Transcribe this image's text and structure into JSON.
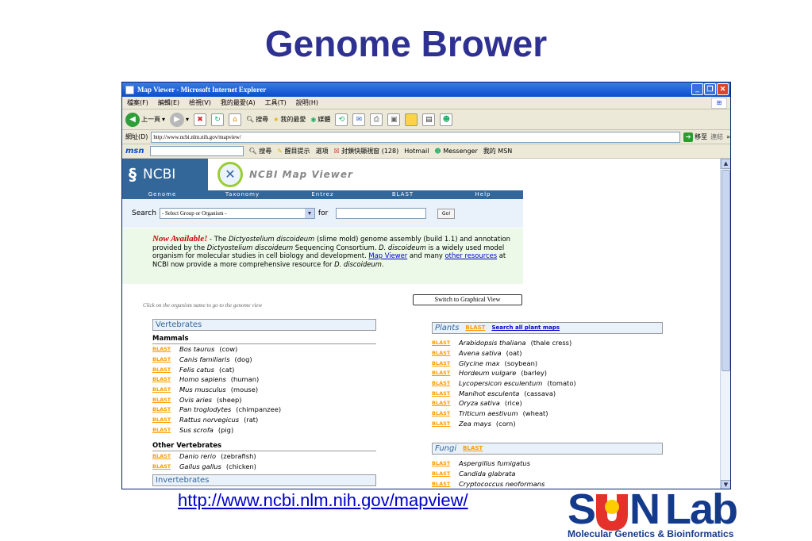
{
  "slide": {
    "title": "Genome Brower",
    "url": "http://www.ncbi.nlm.nih.gov/mapview/"
  },
  "logo": {
    "sun": "S",
    "n": "N",
    "lab": "Lab",
    "subtitle": "Molecular Genetics & Bioinformatics",
    "colors": {
      "blue": "#143a8c",
      "red": "#e4312b",
      "yellow": "#ffcc00"
    }
  },
  "browser": {
    "window_title": "Map Viewer - Microsoft Internet Explorer",
    "menu": [
      "檔案(F)",
      "編輯(E)",
      "檢視(V)",
      "我的最愛(A)",
      "工具(T)",
      "說明(H)"
    ],
    "toolbar": {
      "back": "上一頁",
      "search": "搜尋",
      "favorites": "我的最愛",
      "media": "媒體"
    },
    "address_label": "網址(D)",
    "address": "http://www.ncbi.nlm.nih.gov/mapview/",
    "go_label": "移至",
    "links_label": "連結",
    "msn": {
      "logo": "msn",
      "search": "搜尋",
      "highlight": "醒目提示",
      "options": "選項",
      "popup": "封鎖快顯視窗 (128)",
      "hotmail": "Hotmail",
      "messenger": "Messenger",
      "mymsn": "我的 MSN"
    }
  },
  "page": {
    "ncbi_logo": "NCBI",
    "map_viewer_title": "NCBI Map Viewer",
    "nav": [
      "Genome",
      "Taxonomy",
      "Entrez",
      "BLAST",
      "Help"
    ],
    "search_label": "Search",
    "search_select": "- Select Group or Organism -",
    "for_label": "for",
    "go_button": "Go!",
    "announce": {
      "now": "Now Available!",
      "t1": " - The ",
      "i1": "Dictyostelium discoideum",
      "t2": " (slime mold) genome assembly (build 1.1) and annotation provided by the ",
      "i2": "Dictyostelium discoideum",
      "t3": " Sequencing Consortium. ",
      "i3": "D. discoideum",
      "t4": " is a widely used model organism for molecular studies in cell biology and development. ",
      "link1": "Map Viewer",
      "t5": " and many ",
      "link2": "other resources",
      "t6": " at NCBI now provide a more comprehensive resource for ",
      "i4": "D. discoideum",
      "t7": "."
    },
    "click_hint": "Click on the organism name to go to the genome view",
    "switch_button": "Switch to Graphical View",
    "blast": "BLAST",
    "vertebrates": {
      "title": "Vertebrates",
      "mammals_label": "Mammals",
      "mammals": [
        {
          "sci": "Bos taurus",
          "common": "(cow)"
        },
        {
          "sci": "Canis familiaris",
          "common": "(dog)"
        },
        {
          "sci": "Felis catus",
          "common": "(cat)"
        },
        {
          "sci": "Homo sapiens",
          "common": "(human)"
        },
        {
          "sci": "Mus musculus",
          "common": "(mouse)"
        },
        {
          "sci": "Ovis aries",
          "common": "(sheep)"
        },
        {
          "sci": "Pan troglodytes",
          "common": "(chimpanzee)"
        },
        {
          "sci": "Rattus norvegicus",
          "common": "(rat)"
        },
        {
          "sci": "Sus scrofa",
          "common": "(pig)"
        }
      ],
      "other_label": "Other Vertebrates",
      "other": [
        {
          "sci": "Danio rerio",
          "common": "(zebrafish)"
        },
        {
          "sci": "Gallus gallus",
          "common": "(chicken)"
        }
      ]
    },
    "invertebrates_title": "Invertebrates",
    "plants": {
      "title": "Plants",
      "search_all": "Search all plant maps",
      "items": [
        {
          "sci": "Arabidopsis thaliana",
          "common": "(thale cress)"
        },
        {
          "sci": "Avena sativa",
          "common": "(oat)"
        },
        {
          "sci": "Glycine max",
          "common": "(soybean)"
        },
        {
          "sci": "Hordeum vulgare",
          "common": "(barley)"
        },
        {
          "sci": "Lycopersicon esculentum",
          "common": "(tomato)"
        },
        {
          "sci": "Manihot esculenta",
          "common": "(cassava)"
        },
        {
          "sci": "Oryza sativa",
          "common": "(rice)"
        },
        {
          "sci": "Triticum aestivum",
          "common": "(wheat)"
        },
        {
          "sci": "Zea mays",
          "common": "(corn)"
        }
      ]
    },
    "fungi": {
      "title": "Fungi",
      "items": [
        {
          "sci": "Aspergillus fumigatus",
          "common": ""
        },
        {
          "sci": "Candida glabrata",
          "common": ""
        },
        {
          "sci": "Cryptococcus neoformans",
          "common": ""
        }
      ]
    }
  }
}
